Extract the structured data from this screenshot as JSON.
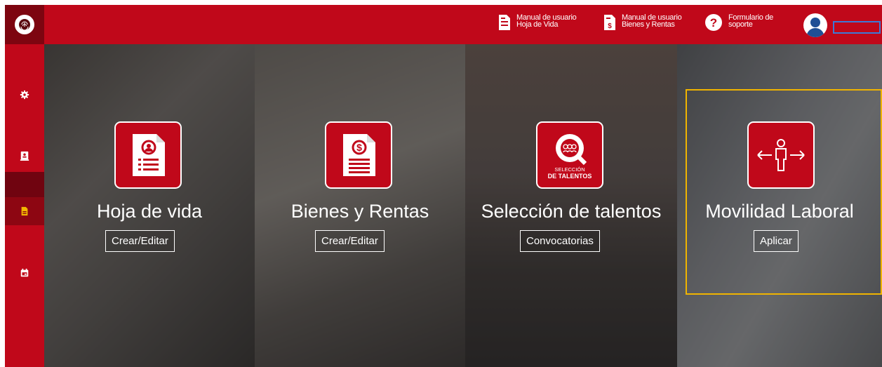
{
  "header": {
    "links": [
      {
        "line1": "Manual de usuario",
        "line2": "Hoja de Vida",
        "icon": "document-icon"
      },
      {
        "line1": "Manual de usuario",
        "line2": "Bienes y Rentas",
        "icon": "document-dollar-icon"
      },
      {
        "line1": "Formulario de",
        "line2": "soporte",
        "icon": "help-icon"
      }
    ],
    "user_name": ""
  },
  "sidebar": {
    "items": [
      {
        "icon": "gear-icon"
      },
      {
        "icon": "id-card-icon"
      },
      {
        "icon": "document-icon"
      },
      {
        "icon": "calendar-icon"
      }
    ]
  },
  "panels": [
    {
      "title": "Hoja de vida",
      "button": "Crear/Editar",
      "icon": "resume-icon"
    },
    {
      "title": "Bienes y Rentas",
      "button": "Crear/Editar",
      "icon": "dollar-document-icon"
    },
    {
      "title": "Selección de talentos",
      "button": "Convocatorias",
      "icon": "talent-selection-icon",
      "icon_text1": "SELECCIÓN",
      "icon_text2": "DE TALENTOS"
    },
    {
      "title": "Movilidad Laboral",
      "button": "Aplicar",
      "icon": "mobility-icon"
    }
  ],
  "colors": {
    "brand": "#c0081a",
    "brand_dark": "#7d0510",
    "highlight": "#f0b400"
  }
}
